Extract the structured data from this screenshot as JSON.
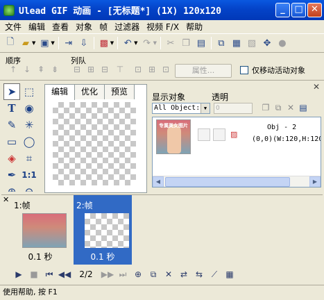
{
  "window": {
    "title": "Ulead GIF 动画 - [无标题*] (1X) 120x120",
    "min": "_",
    "max": "□",
    "close": "✕"
  },
  "menu": [
    "文件",
    "编辑",
    "查看",
    "对象",
    "帧",
    "过滤器",
    "视频 F/X",
    "帮助"
  ],
  "arrange": {
    "order_label": "顺序",
    "align_label": "列队",
    "properties_button": "属性...",
    "move_active_label": "仅移动活动对象"
  },
  "editor_tabs": [
    "编辑",
    "优化",
    "预览"
  ],
  "object_panel": {
    "show_label": "显示对象",
    "transparency_label": "透明",
    "select_value": "All Object:",
    "transparency_value": "0",
    "object": {
      "name": "Obj - 2",
      "position": "(0,0)(W:120,H:120",
      "thumb_text": "专属美女图片"
    }
  },
  "frames": [
    {
      "label": "1:帧",
      "duration": "0.1 秒"
    },
    {
      "label": "2:帧",
      "duration": "0.1 秒",
      "active": true
    }
  ],
  "frame_panel_close": "✕",
  "playback": {
    "counter": "2/2"
  },
  "status": "使用帮助, 按 F1",
  "colors": {
    "title_bar": "#0a58e0",
    "active_frame": "#316ac5",
    "window_bg": "#ece9d8"
  }
}
